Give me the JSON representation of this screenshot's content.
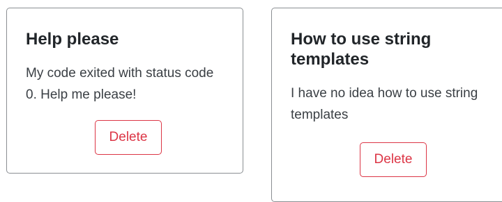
{
  "cards": [
    {
      "title": "Help please",
      "body": "My code exited with status code 0. Help me please!",
      "delete_label": "Delete"
    },
    {
      "title": "How to use string templates",
      "body": "I have no idea how to use string templates",
      "delete_label": "Delete"
    }
  ],
  "colors": {
    "delete_accent": "#dc3545",
    "card_border": "#8a8e92"
  }
}
